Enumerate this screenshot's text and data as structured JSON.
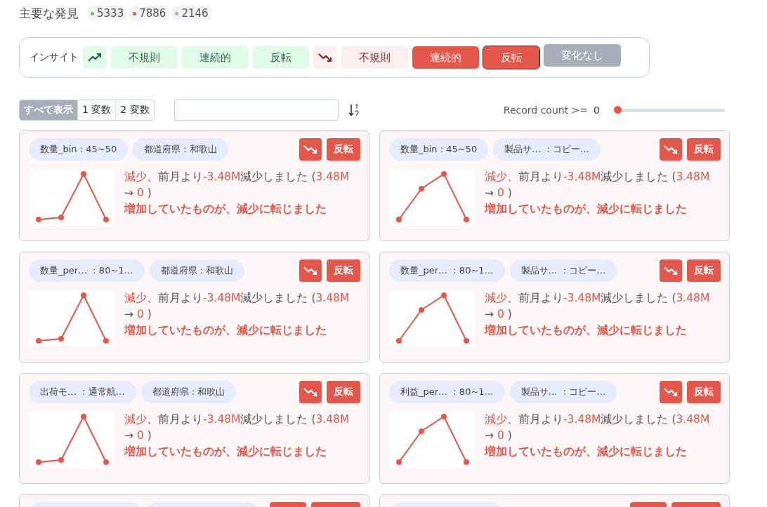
{
  "header": {
    "title": "主要な発見",
    "counts": [
      {
        "value": "5333",
        "color": "#5cbf6a"
      },
      {
        "value": "7886",
        "color": "#e5574a"
      },
      {
        "value": "2146",
        "color": "#a9adb9"
      }
    ]
  },
  "insight_filter": {
    "label": "インサイト",
    "groups": [
      {
        "kind": "increase",
        "options": [
          {
            "label": "不規則",
            "selected": false,
            "focused": false
          },
          {
            "label": "連続的",
            "selected": false,
            "focused": false
          },
          {
            "label": "反転",
            "selected": false,
            "focused": false
          }
        ]
      },
      {
        "kind": "decrease",
        "options": [
          {
            "label": "不規則",
            "selected": false,
            "focused": false
          },
          {
            "label": "連続的",
            "selected": true,
            "focused": false
          },
          {
            "label": "反転",
            "selected": true,
            "focused": true
          }
        ]
      },
      {
        "kind": "unchanged",
        "options": [
          {
            "label": "変化なし",
            "selected": true,
            "focused": false
          }
        ]
      }
    ]
  },
  "toolbar": {
    "view_tabs": [
      {
        "label": "すべて表示",
        "selected": true
      },
      {
        "label": "1 変数",
        "selected": false
      },
      {
        "label": "2 変数",
        "selected": false
      }
    ],
    "record_count": {
      "label": "Record count >=",
      "value": "0",
      "level": 0
    }
  },
  "cards": [
    {
      "tags": [
        "数量_bin : 45~50",
        "都道府県 : 和歌山"
      ],
      "badge": "反転",
      "kind": "flat",
      "lines": [
        [
          {
            "text": "減少",
            "hl": true
          },
          {
            "text": "、前月より",
            "hl": false
          },
          {
            "text": "-3.48M",
            "hl": true
          },
          {
            "text": "減少しました (",
            "hl": false
          },
          {
            "text": "3.48M",
            "hl": true
          },
          {
            "text": " → ",
            "hl": false
          },
          {
            "text": "0",
            "hl": true
          },
          {
            "text": " )",
            "hl": false
          }
        ],
        [
          {
            "text": "増加していたものが、減少に転じました",
            "hl": true
          }
        ]
      ]
    },
    {
      "tags": [
        "数量_bin : 45~50",
        "製品サ…  : コピー…"
      ],
      "badge": "反転",
      "kind": "rise",
      "lines": [
        [
          {
            "text": "減少",
            "hl": true
          },
          {
            "text": "、前月より",
            "hl": false
          },
          {
            "text": "-3.48M",
            "hl": true
          },
          {
            "text": "減少しました (",
            "hl": false
          },
          {
            "text": "3.48M",
            "hl": true
          },
          {
            "text": " → ",
            "hl": false
          },
          {
            "text": "0",
            "hl": true
          },
          {
            "text": " )",
            "hl": false
          }
        ],
        [
          {
            "text": "増加していたものが、減少に転じました",
            "hl": true
          }
        ]
      ]
    },
    {
      "tags": [
        "数量_per…  : 80~1…",
        "都道府県 : 和歌山"
      ],
      "badge": "反転",
      "kind": "flat",
      "lines": [
        [
          {
            "text": "減少",
            "hl": true
          },
          {
            "text": "、前月より",
            "hl": false
          },
          {
            "text": "-3.48M",
            "hl": true
          },
          {
            "text": "減少しました (",
            "hl": false
          },
          {
            "text": "3.48M",
            "hl": true
          },
          {
            "text": " → ",
            "hl": false
          },
          {
            "text": "0",
            "hl": true
          },
          {
            "text": " )",
            "hl": false
          }
        ],
        [
          {
            "text": "増加していたものが、減少に転じました",
            "hl": true
          }
        ]
      ]
    },
    {
      "tags": [
        "数量_per…  : 80~1…",
        "製品サ…  : コピー…"
      ],
      "badge": "反転",
      "kind": "rise",
      "lines": [
        [
          {
            "text": "減少",
            "hl": true
          },
          {
            "text": "、前月より",
            "hl": false
          },
          {
            "text": "-3.48M",
            "hl": true
          },
          {
            "text": "減少しました (",
            "hl": false
          },
          {
            "text": "3.48M",
            "hl": true
          },
          {
            "text": " → ",
            "hl": false
          },
          {
            "text": "0",
            "hl": true
          },
          {
            "text": " )",
            "hl": false
          }
        ],
        [
          {
            "text": "増加していたものが、減少に転じました",
            "hl": true
          }
        ]
      ]
    },
    {
      "tags": [
        "出荷モ…  : 通常航…",
        "都道府県 : 和歌山"
      ],
      "badge": "反転",
      "kind": "flat",
      "lines": [
        [
          {
            "text": "減少",
            "hl": true
          },
          {
            "text": "、前月より",
            "hl": false
          },
          {
            "text": "-3.48M",
            "hl": true
          },
          {
            "text": "減少しました (",
            "hl": false
          },
          {
            "text": "3.48M",
            "hl": true
          },
          {
            "text": " → ",
            "hl": false
          },
          {
            "text": "0",
            "hl": true
          },
          {
            "text": " )",
            "hl": false
          }
        ],
        [
          {
            "text": "増加していたものが、減少に転じました",
            "hl": true
          }
        ]
      ]
    },
    {
      "tags": [
        "利益_per…  : 80~1…",
        "製品サ…  : コピー…"
      ],
      "badge": "反転",
      "kind": "rise",
      "lines": [
        [
          {
            "text": "減少",
            "hl": true
          },
          {
            "text": "、前月より",
            "hl": false
          },
          {
            "text": "-3.48M",
            "hl": true
          },
          {
            "text": "減少しました (",
            "hl": false
          },
          {
            "text": "3.48M",
            "hl": true
          },
          {
            "text": " → ",
            "hl": false
          },
          {
            "text": "0",
            "hl": true
          },
          {
            "text": " )",
            "hl": false
          }
        ],
        [
          {
            "text": "増加していたものが、減少に転じました",
            "hl": true
          }
        ]
      ]
    }
  ],
  "cut_cards": [
    {
      "kind": "double"
    },
    {
      "kind": "single"
    }
  ]
}
